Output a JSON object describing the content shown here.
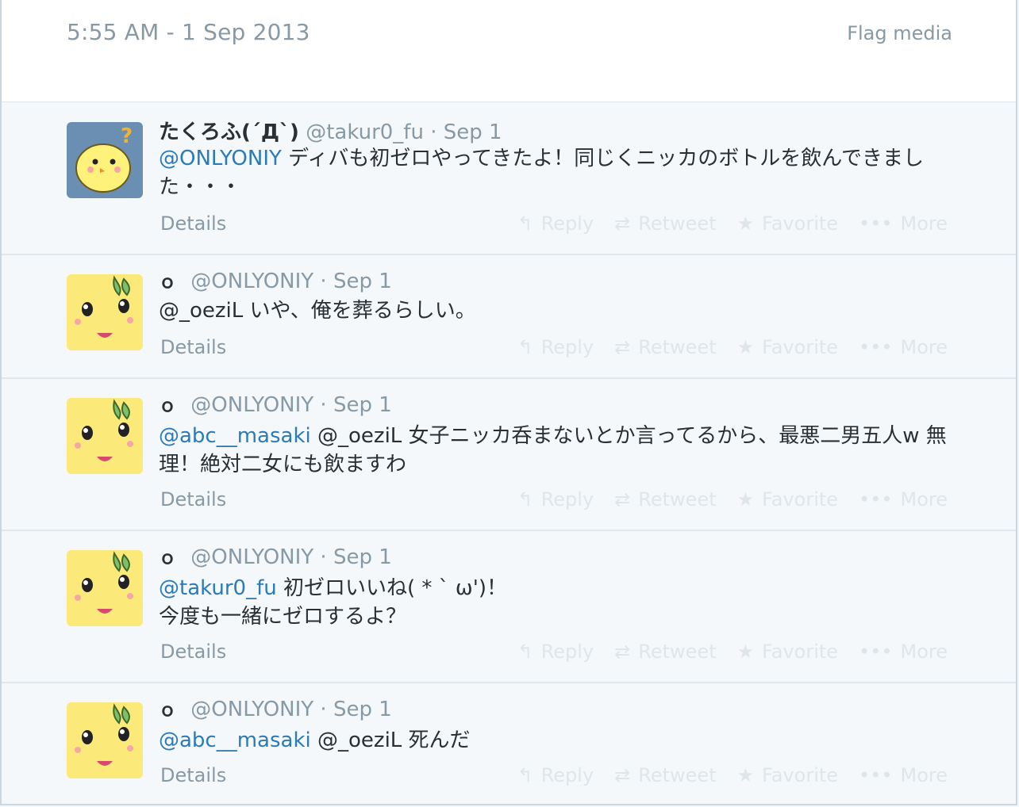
{
  "header": {
    "timestamp": "5:55 AM - 1 Sep 2013",
    "flag_label": "Flag media"
  },
  "actions": {
    "reply": "Reply",
    "retweet": "Retweet",
    "favorite": "Favorite",
    "more": "More",
    "details": "Details"
  },
  "tweets": [
    {
      "name": "たくろふ(´Д`)",
      "handle": "@takur0_fu",
      "sep": "·",
      "date": "Sep 1",
      "mention1": "@ONLYONIY",
      "mention2": "",
      "text": " ディバも初ゼロやってきたよ！同じくニッカのボトルを飲んできました・・・"
    },
    {
      "name": "ｏ",
      "handle": "@ONLYONIY",
      "sep": "·",
      "date": "Sep 1",
      "mention1": "",
      "mention2": "",
      "text": "@_oeziL いや、俺を葬るらしい。"
    },
    {
      "name": "ｏ",
      "handle": "@ONLYONIY",
      "sep": "·",
      "date": "Sep 1",
      "mention1": "@abc__masaki",
      "mention2": "",
      "text": " @_oeziL 女子ニッカ呑まないとか言ってるから、最悪二男五人w 無理！絶対二女にも飲ますわ"
    },
    {
      "name": "ｏ",
      "handle": "@ONLYONIY",
      "sep": "·",
      "date": "Sep 1",
      "mention1": "@takur0_fu",
      "mention2": "",
      "text": " 初ゼロいいね( * ` ω')！ 今度も一緒にゼロするよ？"
    },
    {
      "name": "ｏ",
      "handle": "@ONLYONIY",
      "sep": "·",
      "date": "Sep 1",
      "mention1": "@abc__masaki",
      "mention2": "",
      "text": " @_oeziL 死んだ"
    }
  ],
  "icons": {
    "reply": "reply-arrow-icon",
    "retweet": "retweet-icon",
    "favorite": "star-icon",
    "more": "ellipsis-icon"
  },
  "colors": {
    "mention": "#2b7bb9",
    "muted": "#8899a6",
    "actions": "#dfe6ea"
  }
}
